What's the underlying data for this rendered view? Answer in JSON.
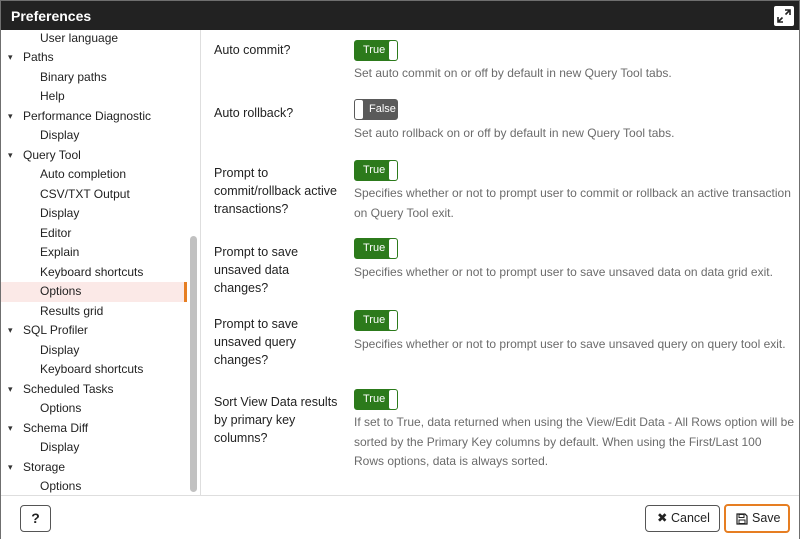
{
  "dialog": {
    "title": "Preferences"
  },
  "sidebar": {
    "items": [
      {
        "label": "User language",
        "level": "child"
      },
      {
        "label": "Paths",
        "level": "parent"
      },
      {
        "label": "Binary paths",
        "level": "child"
      },
      {
        "label": "Help",
        "level": "child"
      },
      {
        "label": "Performance Diagnostic",
        "level": "parent"
      },
      {
        "label": "Display",
        "level": "child"
      },
      {
        "label": "Query Tool",
        "level": "parent"
      },
      {
        "label": "Auto completion",
        "level": "child"
      },
      {
        "label": "CSV/TXT Output",
        "level": "child"
      },
      {
        "label": "Display",
        "level": "child"
      },
      {
        "label": "Editor",
        "level": "child"
      },
      {
        "label": "Explain",
        "level": "child"
      },
      {
        "label": "Keyboard shortcuts",
        "level": "child"
      },
      {
        "label": "Options",
        "level": "child",
        "selected": true
      },
      {
        "label": "Results grid",
        "level": "child"
      },
      {
        "label": "SQL Profiler",
        "level": "parent"
      },
      {
        "label": "Display",
        "level": "child"
      },
      {
        "label": "Keyboard shortcuts",
        "level": "child"
      },
      {
        "label": "Scheduled Tasks",
        "level": "parent"
      },
      {
        "label": "Options",
        "level": "child"
      },
      {
        "label": "Schema Diff",
        "level": "parent"
      },
      {
        "label": "Display",
        "level": "child"
      },
      {
        "label": "Storage",
        "level": "parent"
      },
      {
        "label": "Options",
        "level": "child"
      }
    ]
  },
  "settings": [
    {
      "label": "Auto commit?",
      "value": "True",
      "on": true,
      "help": "Set auto commit on or off by default in new Query Tool tabs."
    },
    {
      "label": "Auto rollback?",
      "value": "False",
      "on": false,
      "help": "Set auto rollback on or off by default in new Query Tool tabs."
    },
    {
      "label": "Prompt to commit/rollback active transactions?",
      "value": "True",
      "on": true,
      "help": "Specifies whether or not to prompt user to commit or rollback an active transaction on Query Tool exit."
    },
    {
      "label": "Prompt to save unsaved data changes?",
      "value": "True",
      "on": true,
      "help": "Specifies whether or not to prompt user to save unsaved data on data grid exit."
    },
    {
      "label": "Prompt to save unsaved query changes?",
      "value": "True",
      "on": true,
      "help": "Specifies whether or not to prompt user to save unsaved query on query tool exit."
    },
    {
      "label": "Sort View Data results by primary key columns?",
      "value": "True",
      "on": true,
      "help": "If set to True, data returned when using the View/Edit Data - All Rows option will be sorted by the Primary Key columns by default. When using the First/Last 100 Rows options, data is always sorted."
    }
  ],
  "footer": {
    "help_label": "?",
    "cancel_label": "Cancel",
    "save_label": "Save"
  },
  "colors": {
    "accent": "#e67e22",
    "toggle_on": "#2c7a1b",
    "toggle_off": "#5a5a5a",
    "titlebar": "#222222",
    "selected_bg": "#fbe9e7"
  },
  "icons": {
    "maximize": "expand-icon",
    "chevron": "chevron-down-icon",
    "cancel": "close-icon",
    "save": "floppy-disk-icon"
  }
}
